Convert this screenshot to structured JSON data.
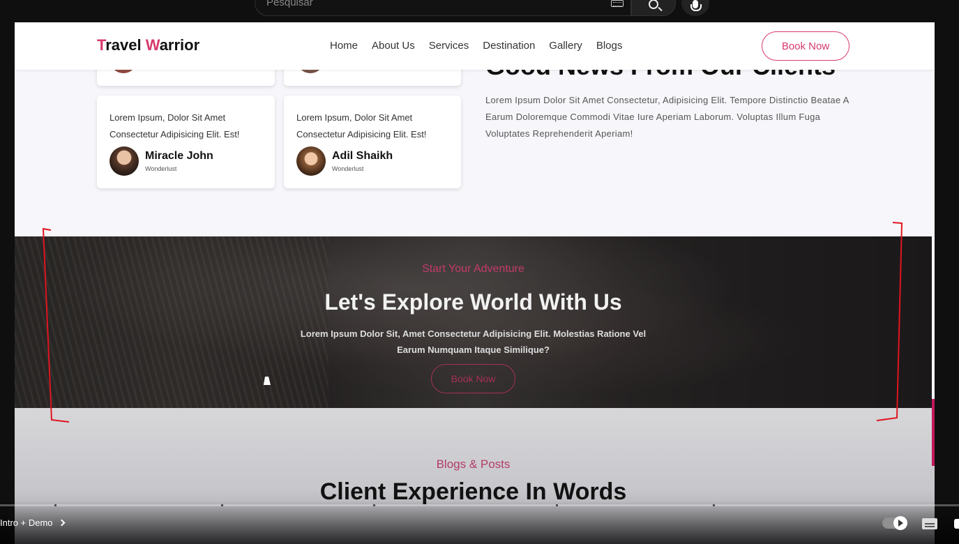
{
  "browser": {
    "search_placeholder": "Pesquisar",
    "icons": [
      "keyboard-icon",
      "search-icon",
      "microphone-icon"
    ]
  },
  "header": {
    "logo": {
      "first_initial": "T",
      "first_rest": "ravel ",
      "second_initial": "W",
      "second_rest": "arrior"
    },
    "nav": [
      "Home",
      "About Us",
      "Services",
      "Destination",
      "Gallery",
      "Blogs"
    ],
    "cta": "Book Now"
  },
  "testimonials": {
    "heading": "Good News From Our Clients",
    "description": "Lorem Ipsum Dolor Sit Amet Consectetur, Adipisicing Elit. Tempore Distinctio Beatae A Earum Doloremque Commodi Vitae Iure Aperiam Laborum. Voluptas Illum Fuga Voluptates Reprehenderit Aperiam!",
    "cards": [
      {
        "quote": "Lorem Ipsum, Dolor Sit Amet Consectetur Adipisicing Elit. Est!",
        "name": "Miracle John",
        "role": "Wonderlust"
      },
      {
        "quote": "Lorem Ipsum, Dolor Sit Amet Consectetur Adipisicing Elit. Est!",
        "name": "Adil Shaikh",
        "role": "Wonderlust"
      }
    ]
  },
  "hero": {
    "subtitle": "Start Your Adventure",
    "title": "Let's Explore World With Us",
    "description": "Lorem Ipsum Dolor Sit, Amet Consectetur Adipisicing Elit. Molestias Ratione Vel Earum Numquam Itaque Similique?",
    "cta": "Book Now"
  },
  "blogs": {
    "subtitle": "Blogs & Posts",
    "title": "Client Experience In Words"
  },
  "player": {
    "chapter": "Intro + Demo",
    "icons": [
      "chevron-right-icon",
      "autoplay-toggle-icon",
      "captions-icon",
      "settings-icon"
    ]
  },
  "colors": {
    "accent": "#d63a6c",
    "header_bg": "#ffffff",
    "page_bg": "#f7f7fb",
    "player_bg": "#0f0f0f"
  }
}
